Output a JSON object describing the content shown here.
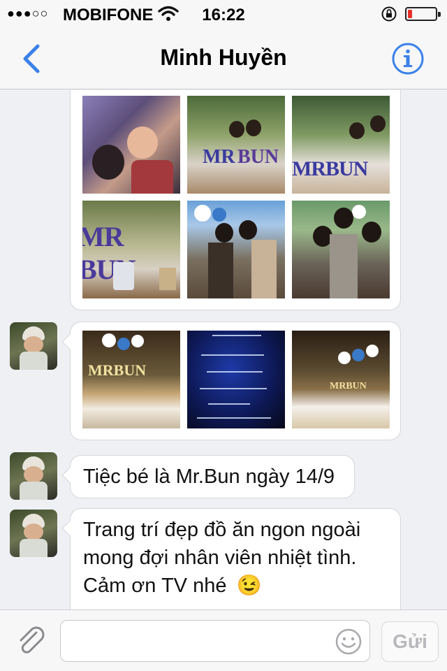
{
  "status_bar": {
    "signal": "●●●○○",
    "carrier": "MOBIFONE",
    "time": "16:22",
    "battery_level": 0.15,
    "icons": [
      "wifi-icon",
      "rotation-lock-icon",
      "battery-icon"
    ]
  },
  "nav": {
    "title": "Minh Huyền",
    "icons": [
      "back-chevron-icon",
      "info-icon"
    ]
  },
  "messages": [
    {
      "type": "photos",
      "count": 6,
      "description_labels": [
        "MR BUN",
        "MR BUN",
        "MR BUN"
      ]
    },
    {
      "type": "photos",
      "count": 3
    },
    {
      "type": "text",
      "text": "Tiệc bé là Mr.Bun ngày 14/9"
    },
    {
      "type": "text",
      "lines": [
        "Trang trí đẹp đồ ăn ngon ngoài",
        "mong đợi nhân viên nhiệt tình.",
        "Cảm ơn TV nhé"
      ],
      "emoji": "😉"
    }
  ],
  "input": {
    "placeholder": "",
    "send_label": "Gửi",
    "icons": [
      "paperclip-icon",
      "smiley-icon"
    ]
  },
  "colors": {
    "accent": "#3b82e8",
    "chat_background": "#eef0f3",
    "bar_background": "#f7f7f8",
    "battery_low": "#e8302a"
  }
}
